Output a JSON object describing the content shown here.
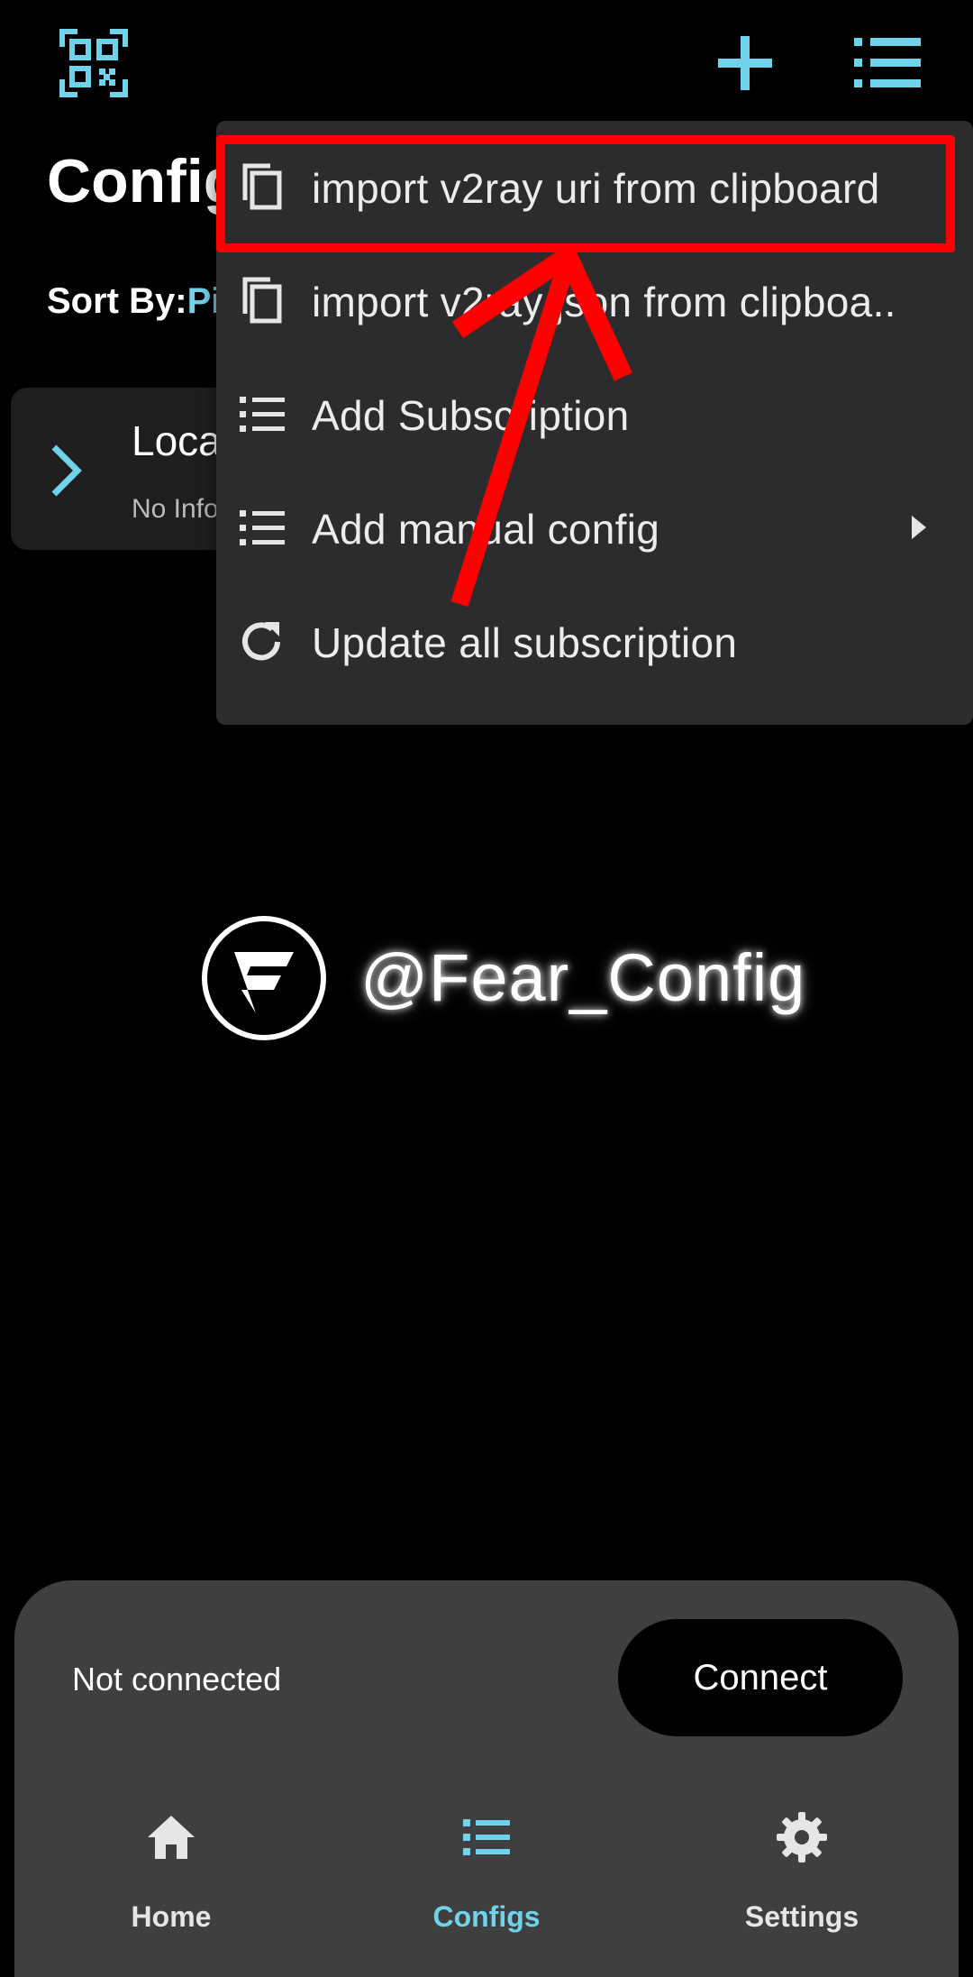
{
  "colors": {
    "background": "#000000",
    "accent": "#6fd3ec",
    "card": "#1e1e1e",
    "menu": "#2c2c2e",
    "bottom_sheet": "#3f3f3f",
    "annotation": "#ff0000"
  },
  "header": {
    "title": "Config",
    "qr_icon": "qr-scan-icon",
    "add_icon": "plus-icon",
    "list_icon": "list-icon"
  },
  "sort": {
    "label": "Sort By:",
    "value": "Pi"
  },
  "config_card": {
    "title": "Loca",
    "subtitle": "No Info",
    "icon": "chevron-right-icon"
  },
  "dropdown": {
    "items": [
      {
        "label": "import v2ray uri from clipboard",
        "icon": "copy-icon"
      },
      {
        "label": "import v2ray json from clipboa..",
        "icon": "copy-icon"
      },
      {
        "label": "Add Subscription",
        "icon": "list-icon"
      },
      {
        "label": "Add manual config",
        "icon": "list-icon",
        "has_submenu": true
      },
      {
        "label": "Update all subscription",
        "icon": "refresh-icon"
      }
    ]
  },
  "watermark": {
    "text": "@Fear_Config",
    "logo_letter": "F"
  },
  "status": {
    "text": "Not connected",
    "button": "Connect"
  },
  "nav": {
    "items": [
      {
        "label": "Home",
        "icon": "home-icon",
        "active": false
      },
      {
        "label": "Configs",
        "icon": "list-icon",
        "active": true
      },
      {
        "label": "Settings",
        "icon": "gear-icon",
        "active": false
      }
    ]
  }
}
